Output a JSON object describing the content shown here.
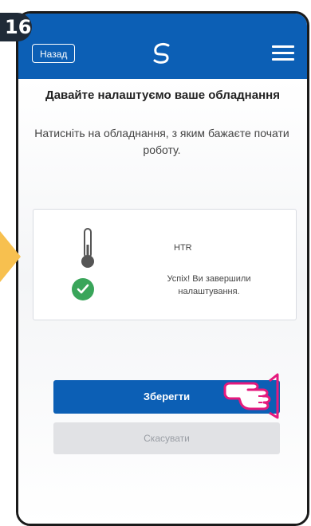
{
  "step_number": "16",
  "header": {
    "back_label": "Назад",
    "logo_icon": "salus-logo-icon",
    "menu_icon": "hamburger-menu-icon",
    "background": "#0c5fb5"
  },
  "main": {
    "title": "Давайте налаштуємо ваше обладнання",
    "subtitle": "Натисніть на обладнання, з яким бажаєте почати роботу."
  },
  "device_card": {
    "device_icon": "thermometer-icon",
    "device_name": "HTR",
    "status_icon": "checkmark-circle-icon",
    "status_text": "Успіх! Ви завершили налаштування.",
    "success_color": "#39a55a"
  },
  "actions": {
    "save_label": "Зберегти",
    "cancel_label": "Скасувати",
    "accent": "#0c5fb5"
  },
  "annotations": {
    "pointer_icon": "hand-pointer-icon",
    "pointer_color": "#e5197d",
    "arrow_color": "#f7c04f"
  }
}
